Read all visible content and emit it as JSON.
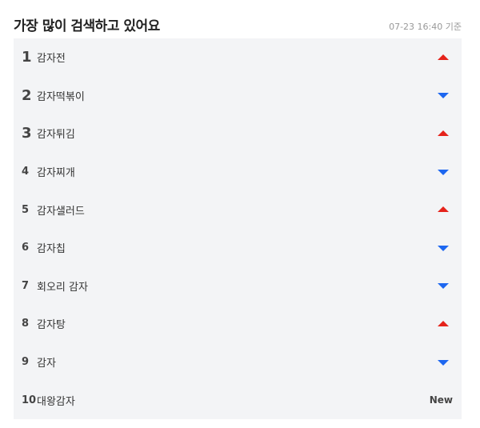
{
  "header": {
    "title": "가장 많이 검색하고 있어요",
    "timestamp": "07-23 16:40 기준"
  },
  "colors": {
    "up": "#e5231b",
    "down": "#1d67f0",
    "background": "#f3f4f6"
  },
  "items": [
    {
      "rank": "1",
      "keyword": "감자전",
      "trend": "up"
    },
    {
      "rank": "2",
      "keyword": "감자떡볶이",
      "trend": "down"
    },
    {
      "rank": "3",
      "keyword": "감자튀김",
      "trend": "up"
    },
    {
      "rank": "4",
      "keyword": "감자찌개",
      "trend": "down"
    },
    {
      "rank": "5",
      "keyword": "감자샐러드",
      "trend": "up"
    },
    {
      "rank": "6",
      "keyword": "감자칩",
      "trend": "down"
    },
    {
      "rank": "7",
      "keyword": "회오리 감자",
      "trend": "down"
    },
    {
      "rank": "8",
      "keyword": "감자탕",
      "trend": "up"
    },
    {
      "rank": "9",
      "keyword": "감자",
      "trend": "down"
    },
    {
      "rank": "10",
      "keyword": "대왕감자",
      "trend": "new",
      "trend_label": "New"
    }
  ]
}
